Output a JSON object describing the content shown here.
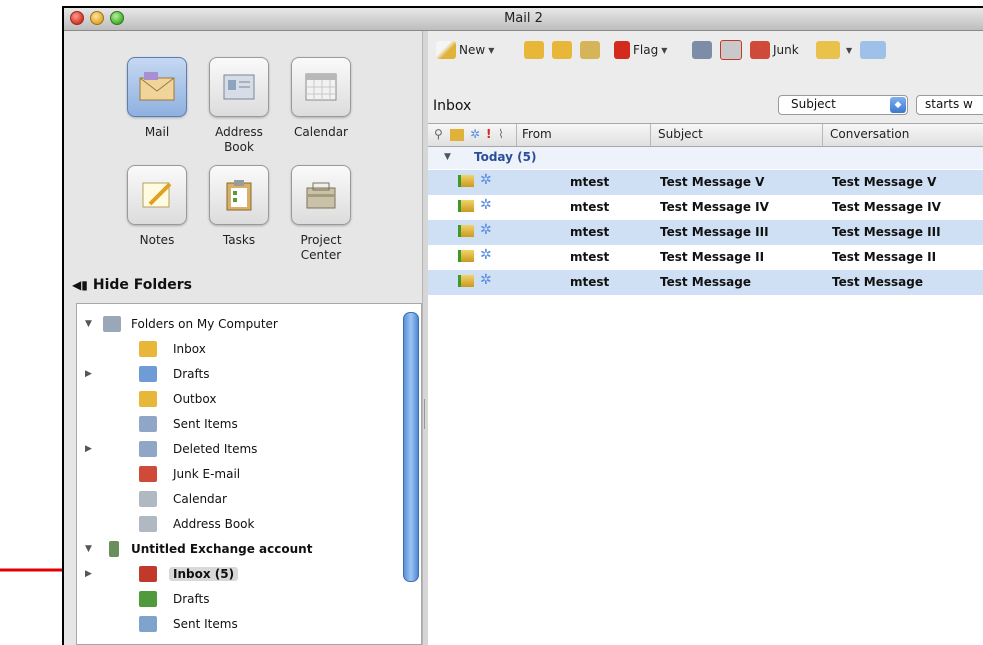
{
  "window": {
    "title": "Mail 2"
  },
  "nav_tiles": [
    {
      "label": "Mail",
      "active": true
    },
    {
      "label": "Address Book"
    },
    {
      "label": "Calendar"
    },
    {
      "label": "Notes"
    },
    {
      "label": "Tasks"
    },
    {
      "label": "Project Center"
    }
  ],
  "sidebar": {
    "hide_folders": "Hide Folders",
    "folders": [
      {
        "label": "Folders on My Computer",
        "icon": "computer-folder-icon",
        "expander": "open",
        "color": "#9aa7b8"
      },
      {
        "label": "Inbox",
        "icon": "inbox-icon",
        "color": "#e8b73a"
      },
      {
        "label": "Drafts",
        "icon": "drafts-icon",
        "expander": "closed",
        "color": "#6f9bd6"
      },
      {
        "label": "Outbox",
        "icon": "outbox-icon",
        "color": "#e8b73a"
      },
      {
        "label": "Sent Items",
        "icon": "sent-items-icon",
        "color": "#8fa6c9"
      },
      {
        "label": "Deleted Items",
        "icon": "deleted-items-icon",
        "expander": "closed",
        "color": "#8fa6c9"
      },
      {
        "label": "Junk E-mail",
        "icon": "junk-icon",
        "color": "#d04a3a"
      },
      {
        "label": "Calendar",
        "icon": "calendar-icon",
        "color": "#b0b8c2"
      },
      {
        "label": "Address Book",
        "icon": "address-book-icon",
        "color": "#b0b8c2"
      },
      {
        "label": "Untitled Exchange account",
        "icon": "exchange-account-icon",
        "expander": "open",
        "bold": true,
        "color": "#6b8f5a"
      },
      {
        "label": "Inbox (5)",
        "icon": "exchange-inbox-icon",
        "expander": "closed",
        "bold": true,
        "selected": true,
        "color": "#c0392b"
      },
      {
        "label": "Drafts",
        "icon": "exchange-drafts-icon",
        "color": "#4f9a3a"
      },
      {
        "label": "Sent Items",
        "icon": "exchange-sent-icon",
        "color": "#7fa3cc"
      }
    ]
  },
  "toolbar": {
    "new_label": "New",
    "flag_label": "Flag",
    "junk_label": "Junk"
  },
  "inbox": {
    "title": "Inbox",
    "search_field": "Subject",
    "search_mode": "starts w"
  },
  "message_list": {
    "columns": [
      "From",
      "Subject",
      "Conversation"
    ],
    "group_label": "Today (5)",
    "rows": [
      {
        "from": "mtest",
        "subject": "Test Message V",
        "conversation": "Test Message V"
      },
      {
        "from": "mtest",
        "subject": "Test Message IV",
        "conversation": "Test Message IV"
      },
      {
        "from": "mtest",
        "subject": "Test Message III",
        "conversation": "Test Message III"
      },
      {
        "from": "mtest",
        "subject": "Test Message II",
        "conversation": "Test Message II"
      },
      {
        "from": "mtest",
        "subject": "Test Message",
        "conversation": "Test Message"
      }
    ]
  },
  "annotation": {
    "arrow_color": "#e00000"
  }
}
